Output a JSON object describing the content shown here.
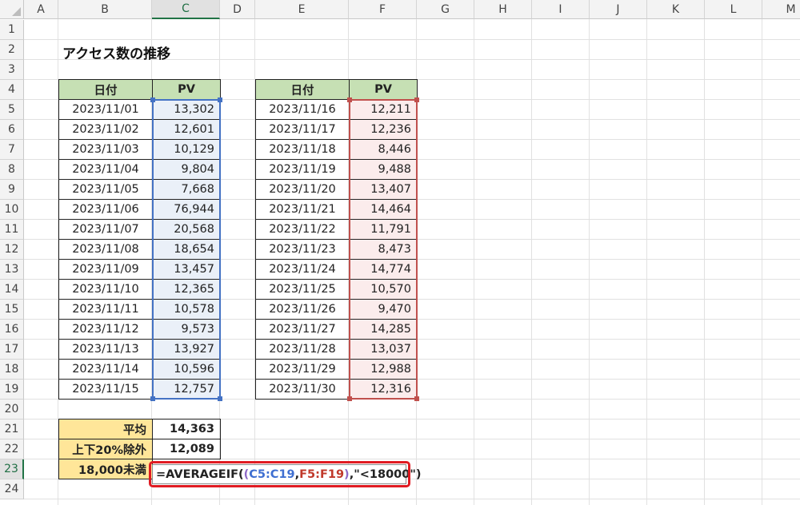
{
  "columns": [
    "A",
    "B",
    "C",
    "D",
    "E",
    "F",
    "G",
    "H",
    "I",
    "J",
    "K",
    "L",
    "M"
  ],
  "active_column": "C",
  "rows": [
    "1",
    "2",
    "3",
    "4",
    "5",
    "6",
    "7",
    "8",
    "9",
    "10",
    "11",
    "12",
    "13",
    "14",
    "15",
    "16",
    "17",
    "18",
    "19",
    "20",
    "21",
    "22",
    "23",
    "24"
  ],
  "active_row": "23",
  "title": "アクセス数の推移",
  "table_left": {
    "headers": [
      "日付",
      "PV"
    ],
    "rows": [
      [
        "2023/11/01",
        "13,302"
      ],
      [
        "2023/11/02",
        "12,601"
      ],
      [
        "2023/11/03",
        "10,129"
      ],
      [
        "2023/11/04",
        "9,804"
      ],
      [
        "2023/11/05",
        "7,668"
      ],
      [
        "2023/11/06",
        "76,944"
      ],
      [
        "2023/11/07",
        "20,568"
      ],
      [
        "2023/11/08",
        "18,654"
      ],
      [
        "2023/11/09",
        "13,457"
      ],
      [
        "2023/11/10",
        "12,365"
      ],
      [
        "2023/11/11",
        "10,578"
      ],
      [
        "2023/11/12",
        "9,573"
      ],
      [
        "2023/11/13",
        "13,927"
      ],
      [
        "2023/11/14",
        "10,596"
      ],
      [
        "2023/11/15",
        "12,757"
      ]
    ]
  },
  "table_right": {
    "headers": [
      "日付",
      "PV"
    ],
    "rows": [
      [
        "2023/11/16",
        "12,211"
      ],
      [
        "2023/11/17",
        "12,236"
      ],
      [
        "2023/11/18",
        "8,446"
      ],
      [
        "2023/11/19",
        "9,488"
      ],
      [
        "2023/11/20",
        "13,407"
      ],
      [
        "2023/11/21",
        "14,464"
      ],
      [
        "2023/11/22",
        "11,791"
      ],
      [
        "2023/11/23",
        "8,473"
      ],
      [
        "2023/11/24",
        "14,774"
      ],
      [
        "2023/11/25",
        "10,570"
      ],
      [
        "2023/11/26",
        "9,470"
      ],
      [
        "2023/11/27",
        "14,285"
      ],
      [
        "2023/11/28",
        "13,037"
      ],
      [
        "2023/11/29",
        "12,988"
      ],
      [
        "2023/11/30",
        "12,316"
      ]
    ]
  },
  "summary": [
    {
      "label": "平均",
      "value": "14,363"
    },
    {
      "label": "上下20%除外",
      "value": "12,089"
    },
    {
      "label": "18,000未満",
      "value": ""
    }
  ],
  "formula": {
    "prefix": "=AVERAGEIF(",
    "paren_outer": "(",
    "range1": "C5:C19",
    "comma": ",",
    "range2": "F5:F19",
    "paren_close": ")",
    "suffix": ",\"<18000\")"
  },
  "colors": {
    "header_green": "#c6e0b4",
    "summary_yellow": "#ffe699",
    "range_blue": "#4472c4",
    "range_red": "#c0504d",
    "highlight_red": "#e01b22"
  }
}
